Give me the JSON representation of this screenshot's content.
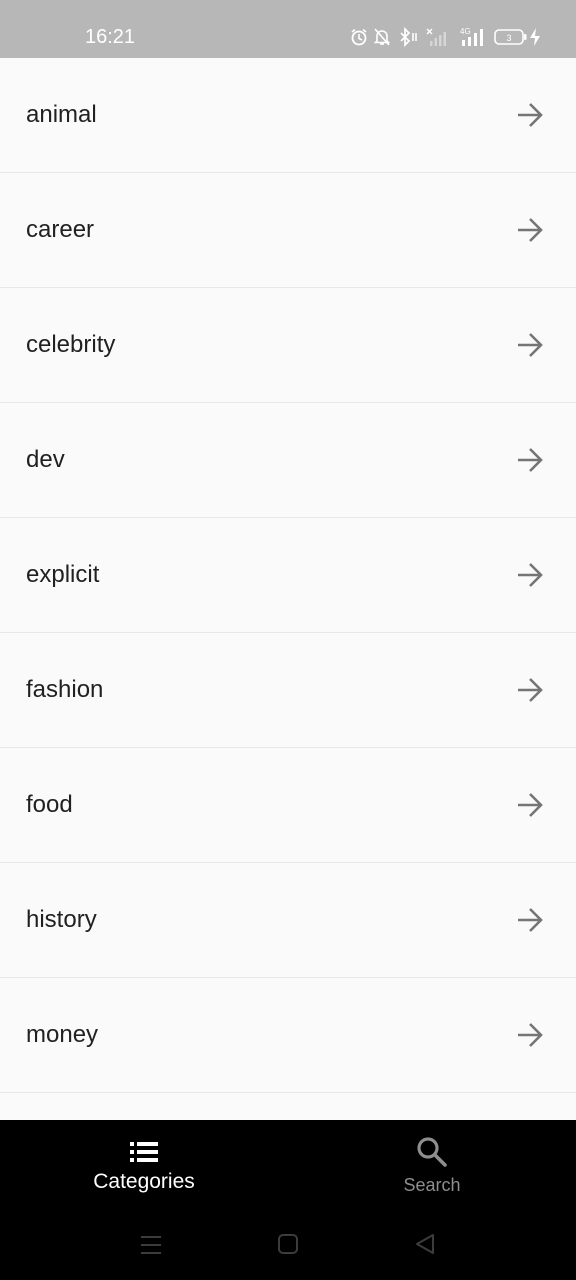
{
  "status_bar": {
    "time": "16:21",
    "network": "4G",
    "battery": "3",
    "icons": [
      "alarm-icon",
      "mute-bell-icon",
      "bluetooth-icon",
      "signal-off-icon",
      "signal-4g-icon",
      "battery-icon",
      "charging-bolt-icon"
    ]
  },
  "categories": [
    {
      "label": "animal"
    },
    {
      "label": "career"
    },
    {
      "label": "celebrity"
    },
    {
      "label": "dev"
    },
    {
      "label": "explicit"
    },
    {
      "label": "fashion"
    },
    {
      "label": "food"
    },
    {
      "label": "history"
    },
    {
      "label": "money"
    },
    {
      "label": ""
    }
  ],
  "bottom_nav": {
    "tabs": [
      {
        "label": "Categories",
        "icon": "list-icon",
        "active": true
      },
      {
        "label": "Search",
        "icon": "search-icon",
        "active": false
      }
    ]
  },
  "colors": {
    "status_bar": "#b7b7b7",
    "list_bg": "#fafafa",
    "divider": "#e7e7e7",
    "arrow": "#757575",
    "nav_bg": "#000000",
    "active_tab": "#ffffff",
    "inactive_tab": "#8e8e8e"
  },
  "system_nav": [
    "menu-icon",
    "home-icon",
    "back-icon"
  ]
}
